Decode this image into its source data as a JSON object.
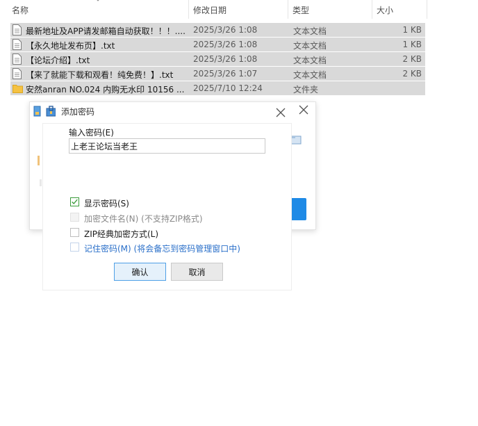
{
  "file_list": {
    "columns": {
      "name": "名称",
      "date": "修改日期",
      "type": "类型",
      "size": "大小"
    },
    "rows": [
      {
        "name": "最新地址及APP请发邮箱自动获取！！！....",
        "date": "2025/3/26 1:08",
        "type": "文本文档",
        "size": "1 KB",
        "icon": "text-file-icon"
      },
      {
        "name": "【永久地址发布页】.txt",
        "date": "2025/3/26 1:08",
        "type": "文本文档",
        "size": "1 KB",
        "icon": "text-file-icon"
      },
      {
        "name": "【论坛介绍】.txt",
        "date": "2025/3/26 1:08",
        "type": "文本文档",
        "size": "2 KB",
        "icon": "text-file-icon"
      },
      {
        "name": "【来了就能下载和观看！纯免费！】.txt",
        "date": "2025/3/26 1:07",
        "type": "文本文档",
        "size": "2 KB",
        "icon": "text-file-icon"
      },
      {
        "name": "安然anran NO.024 内购无水印 10156 ...",
        "date": "2025/7/10 12:24",
        "type": "文件夹",
        "size": "",
        "icon": "folder-icon"
      }
    ]
  },
  "dialog": {
    "title": "添加密码",
    "password_label": "输入密码(E)",
    "password_value": "上老王论坛当老王",
    "options": {
      "show_password": {
        "label": "显示密码(S)",
        "checked": true,
        "enabled": true
      },
      "encrypt_filenames": {
        "label": "加密文件名(N) (不支持ZIP格式)",
        "checked": false,
        "enabled": false
      },
      "zip_classic": {
        "label": "ZIP经典加密方式(L)",
        "checked": false,
        "enabled": true
      },
      "remember_password": {
        "label": "记住密码(M) (将会备忘到密码管理窗口中)",
        "checked": false,
        "enabled": true
      }
    },
    "ok_label": "确认",
    "cancel_label": "取消"
  },
  "colors": {
    "selection": "#d9d9d9",
    "accent_blue": "#1e8ae6",
    "link_blue": "#2a6fc9",
    "check_green": "#3a9b3a",
    "folder_yellow": "#f5c242"
  }
}
